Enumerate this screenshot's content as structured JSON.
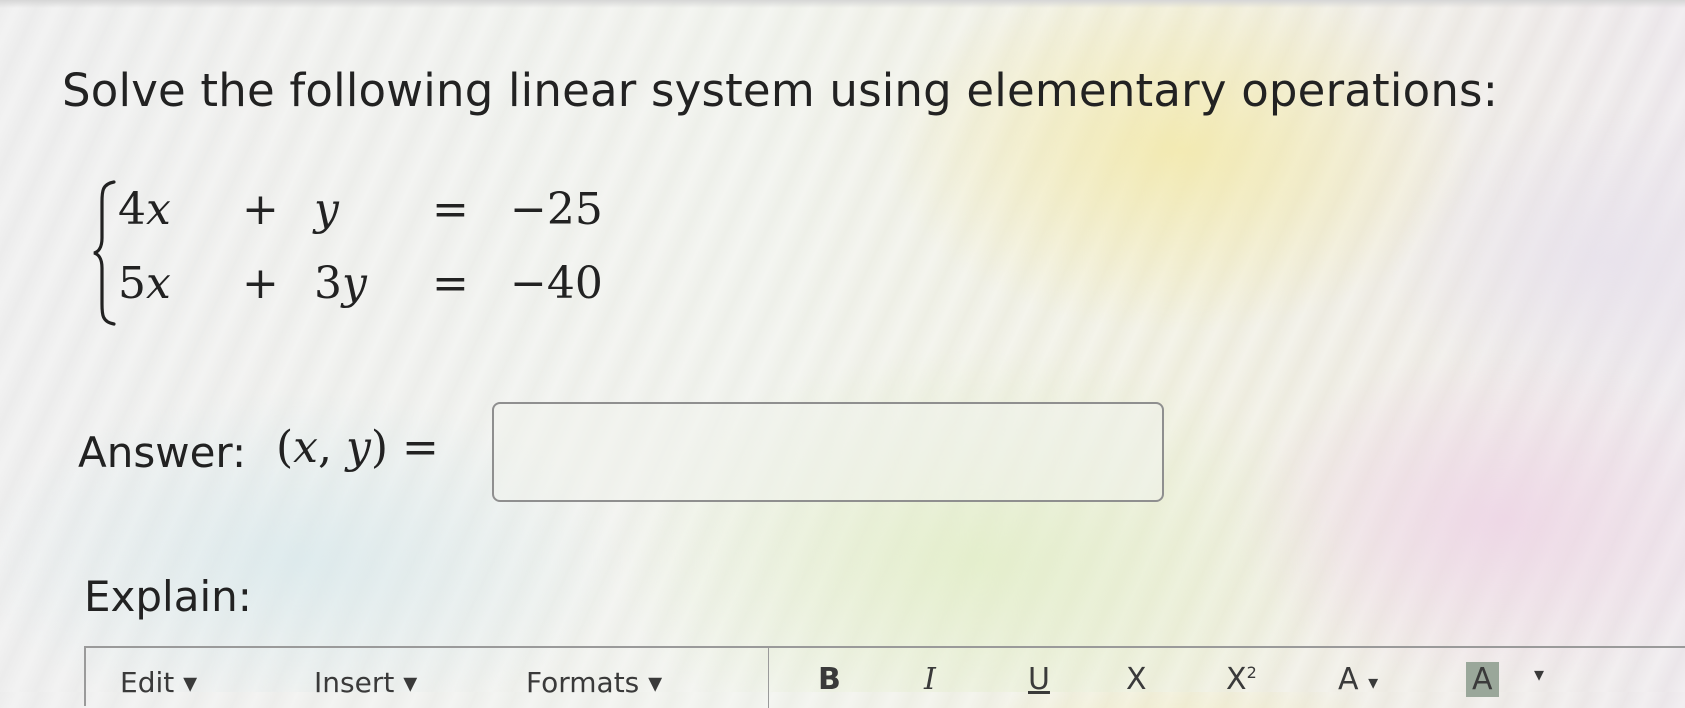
{
  "question": {
    "text": "Solve the following linear system using elementary operations:"
  },
  "system": {
    "rows": [
      {
        "coef_x": "4",
        "var_x": "x",
        "op": "+",
        "coef_y": "",
        "var_y": "y",
        "eq": "=",
        "rhs": "−25"
      },
      {
        "coef_x": "5",
        "var_x": "x",
        "op": "+",
        "coef_y": "3",
        "var_y": "y",
        "eq": "=",
        "rhs": "−40"
      }
    ]
  },
  "answer": {
    "label": "Answer:",
    "math_open": "(",
    "math_x": "x",
    "math_sep": ", ",
    "math_y": "y",
    "math_close": ")",
    "math_eq": " =",
    "input_value": ""
  },
  "explain": {
    "label": "Explain:"
  },
  "toolbar": {
    "edit": "Edit",
    "insert": "Insert",
    "formats": "Formats",
    "bold": "B",
    "italic": "I",
    "underline": "U",
    "subscript": "X",
    "superscript": "X",
    "superscript_mark": "2",
    "font_color": "A",
    "background_color": "A",
    "text_color_hex": "#555555",
    "highlight_hex": "#9aa79a"
  }
}
